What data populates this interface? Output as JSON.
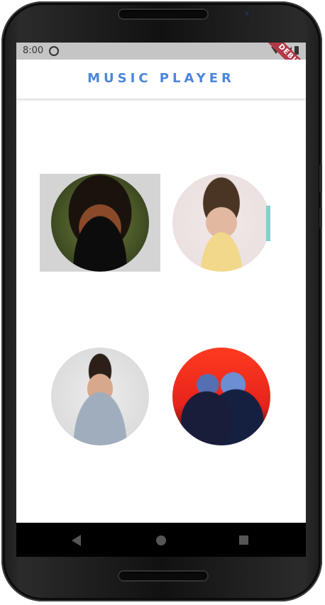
{
  "status_bar": {
    "time": "8:00",
    "debug_label": "DEBUG"
  },
  "app_bar": {
    "title": "MUSIC PLAYER"
  },
  "artists": [
    {
      "icon": "the-weeknd-photo",
      "selected": true
    },
    {
      "icon": "harry-styles-photo",
      "selected": false
    },
    {
      "icon": "shawn-mendes-photo",
      "selected": false
    },
    {
      "icon": "band-photo",
      "selected": false
    }
  ],
  "colors": {
    "title": "#4b86dc",
    "status_bar_bg": "#c5c5c5",
    "debug_ribbon": "#b23a48",
    "selected_bg": "#d4d4d4"
  }
}
